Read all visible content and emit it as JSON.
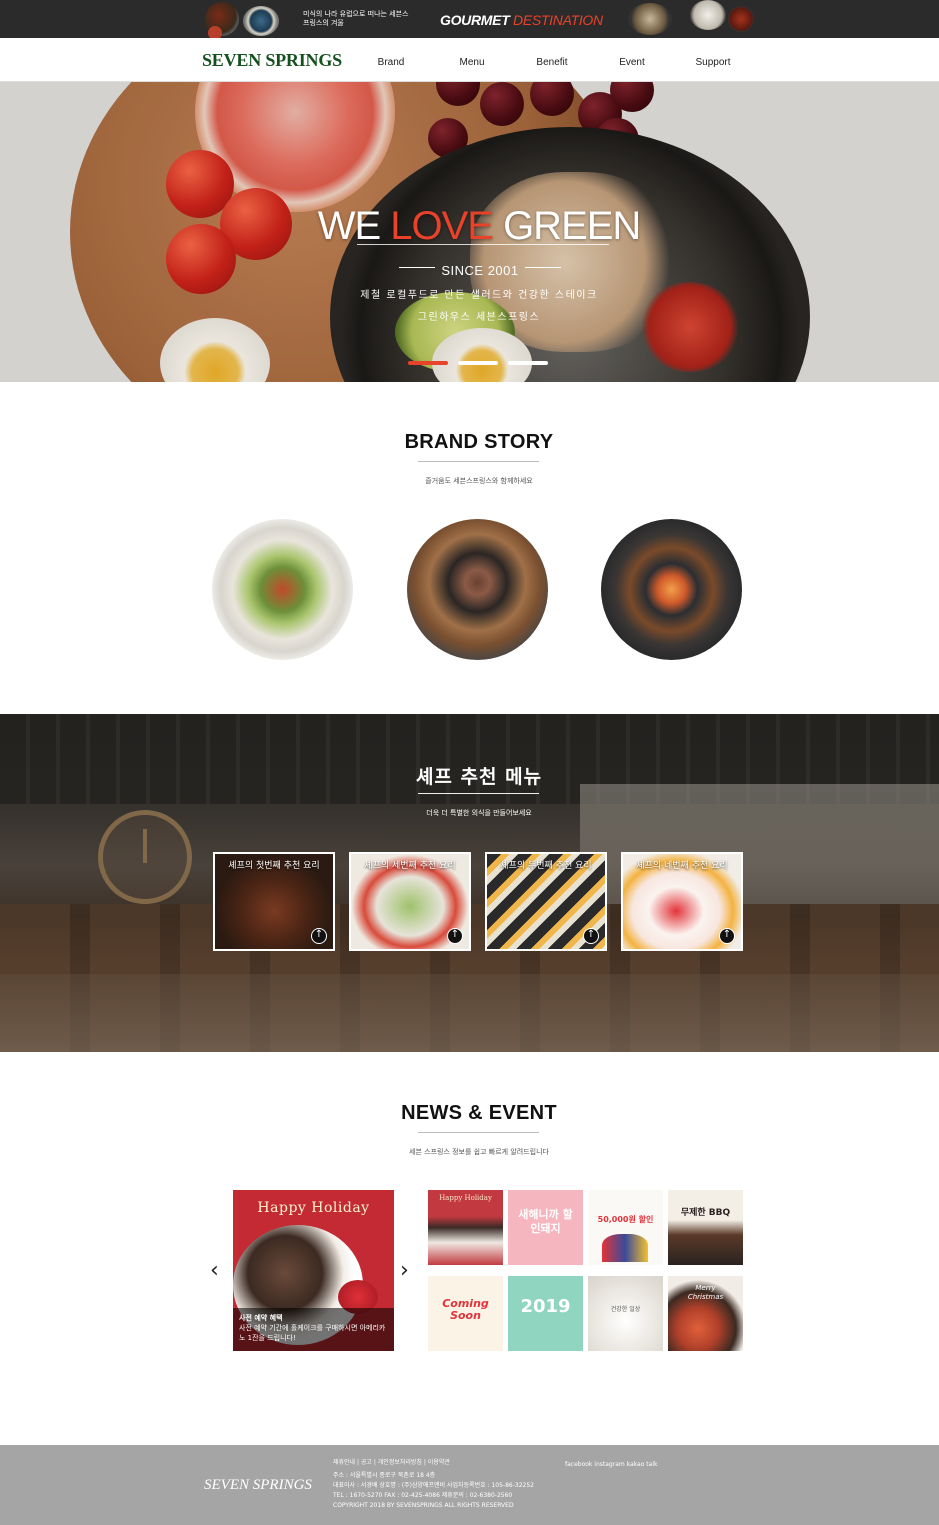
{
  "promo": {
    "subtitle": "미식의 나라 유럽으로 떠나는 세븐스프링스의 겨울",
    "title": "GOURMET",
    "title_accent": "DESTINATION"
  },
  "nav": {
    "logo": "SEVEN SPRINGS",
    "items": [
      "Brand",
      "Menu",
      "Benefit",
      "Event",
      "Support"
    ]
  },
  "hero": {
    "title_a": "WE ",
    "title_b": "LOVE",
    "title_c": " GREEN",
    "since": "SINCE 2001",
    "desc1": "제철 로컬푸드로 만든 샐러드와 건강한 스테이크",
    "desc2": "그린하우스 세븐스프링스",
    "active_slide": 1,
    "slide_count": 3,
    "accent": "#e8432a"
  },
  "brand": {
    "title": "BRAND STORY",
    "subtitle": "즐거움도 세븐스프링스와 함께하세요"
  },
  "chef": {
    "title": "셰프 추천 메뉴",
    "subtitle": "더욱 더 특별한 외식을 만들어보세요",
    "cards": [
      {
        "title": "셰프의 첫번째 추천 요리"
      },
      {
        "title": "셰프의 세번째 추천 요리"
      },
      {
        "title": "셰프의 두번째 추천 요리"
      },
      {
        "title": "셰프의 네번째 추천 요리"
      }
    ]
  },
  "news": {
    "title": "NEWS & EVENT",
    "subtitle": "세븐 스프링스 정보를 쉽고 빠르게 알려드립니다",
    "main": {
      "banner": "Happy Holiday",
      "caption_title": "사전 예약 혜택",
      "caption_desc": "사전 예약 기간에 홀케이크를 구매하시면 아메리카노 1잔을 드립니다!"
    },
    "prev_icon": "chevron-left-icon",
    "next_icon": "chevron-right-icon",
    "thumbs": [
      {
        "label": "Happy Holiday"
      },
      {
        "label": "새해니까 할인돼지"
      },
      {
        "label": "50,000원 할인"
      },
      {
        "label": "무제한 BBQ"
      },
      {
        "label": "Coming Soon"
      },
      {
        "label": "2019"
      },
      {
        "label": "건강한 일상"
      },
      {
        "label": "Merry Christmas"
      }
    ]
  },
  "footer": {
    "logo": "SEVEN SPRINGS",
    "links": "제휴안내 | 공고 | 개인정보처리방침 | 이용약관",
    "address": "주소 : 서울특별시 종로구 북촌로 18 4층",
    "company": "대표이사 : 서경배    상호명 : (주)삼양에프앤비    사업자등록번호 : 105-86-32252",
    "contact": "TEL : 1670-5270    FAX : 02-425-4086    제휴문의 : 02-6380-2560",
    "copyright": "COPYRIGHT 2018 BY SEVENSPRINGS ALL RIGHTS RESERVED",
    "social": "facebook  instagram  kakao talk"
  }
}
